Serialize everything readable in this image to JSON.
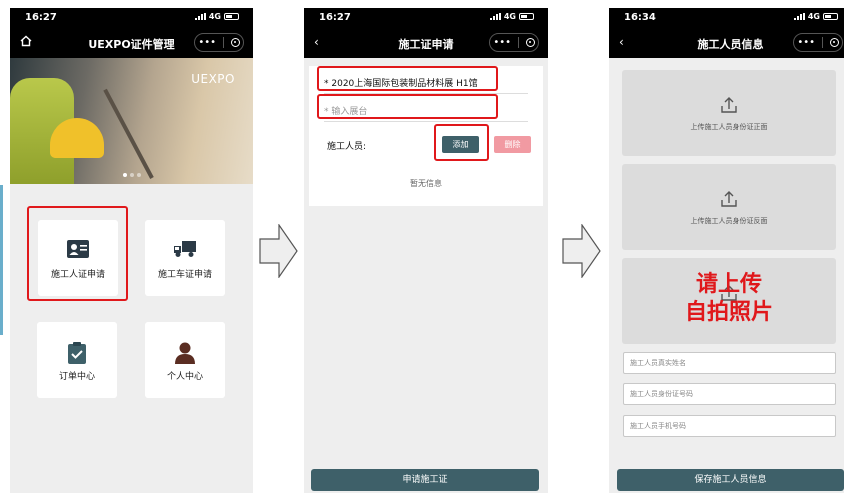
{
  "status": {
    "time1": "16:27",
    "time2": "16:27",
    "time3": "16:34",
    "network": "4G"
  },
  "screen1": {
    "nav_title": "UEXPO证件管理",
    "banner_brand": "UEXPO",
    "tiles": [
      "施工人证申请",
      "施工车证申请",
      "订单中心",
      "个人中心"
    ]
  },
  "screen2": {
    "nav_title": "施工证申请",
    "exhibition_value": "* 2020上海国际包装制品材料展 H1馆",
    "booth_placeholder": "* 输入展台",
    "workers_label": "施工人员:",
    "add_label": "添加",
    "delete_label": "删除",
    "empty_text": "暂无信息",
    "submit_label": "申请施工证"
  },
  "screen3": {
    "nav_title": "施工人员信息",
    "upload_front": "上传施工人员身份证正面",
    "upload_back": "上传施工人员身份证反面",
    "overlay_line1": "请上传",
    "overlay_line2": "自拍照片",
    "name_placeholder": "施工人员真实姓名",
    "id_placeholder": "施工人员身份证号码",
    "phone_placeholder": "施工人员手机号码",
    "save_label": "保存施工人员信息"
  },
  "colors": {
    "accent": "#3e6069",
    "highlight": "#e0181b",
    "delete": "#f19aa2"
  }
}
